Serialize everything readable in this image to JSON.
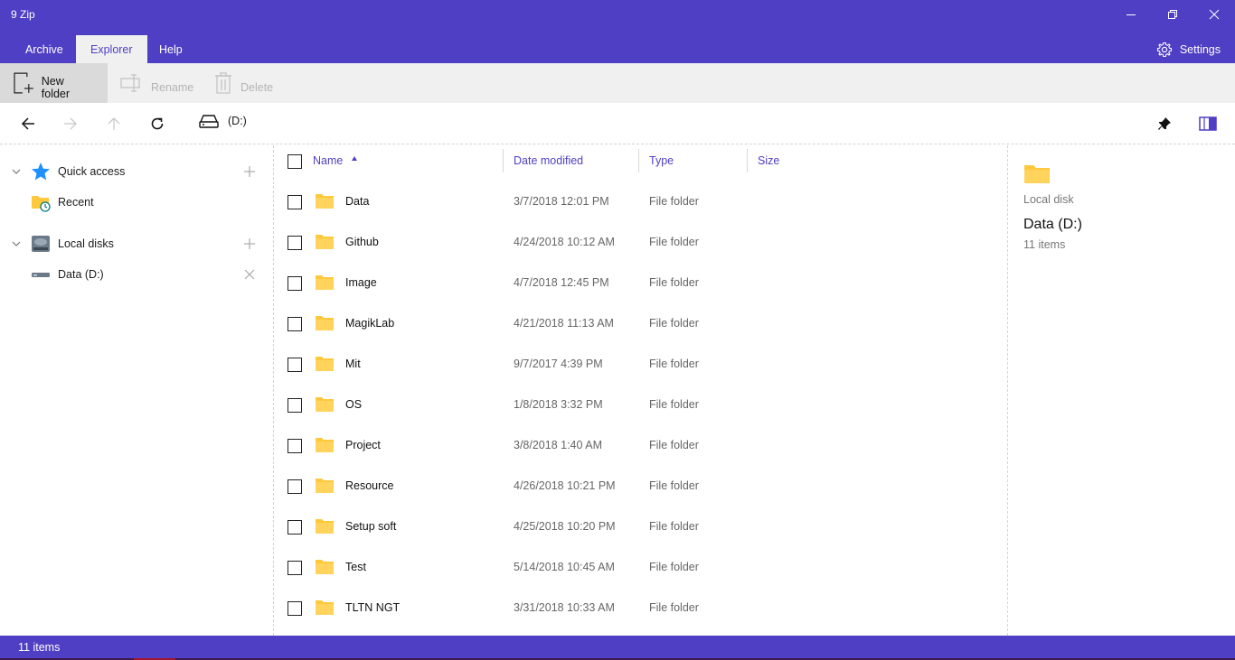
{
  "window": {
    "title": "9 Zip"
  },
  "tabs": [
    {
      "label": "Archive",
      "active": false
    },
    {
      "label": "Explorer",
      "active": true
    },
    {
      "label": "Help",
      "active": false
    }
  ],
  "settings_label": "Settings",
  "ribbon": {
    "new_folder": "New folder",
    "rename": "Rename",
    "delete": "Delete"
  },
  "nav": {
    "path": "(D:)"
  },
  "sidebar": {
    "quick_access": "Quick access",
    "recent": "Recent",
    "local_disks": "Local disks",
    "data_drive": "Data (D:)"
  },
  "columns": {
    "name": "Name",
    "date_modified": "Date modified",
    "type": "Type",
    "size": "Size"
  },
  "files": [
    {
      "name": "Data",
      "date": "3/7/2018 12:01 PM",
      "type": "File folder"
    },
    {
      "name": "Github",
      "date": "4/24/2018 10:12 AM",
      "type": "File folder"
    },
    {
      "name": "Image",
      "date": "4/7/2018 12:45 PM",
      "type": "File folder"
    },
    {
      "name": "MagikLab",
      "date": "4/21/2018 11:13 AM",
      "type": "File folder"
    },
    {
      "name": "Mit",
      "date": "9/7/2017 4:39 PM",
      "type": "File folder"
    },
    {
      "name": "OS",
      "date": "1/8/2018 3:32 PM",
      "type": "File folder"
    },
    {
      "name": "Project",
      "date": "3/8/2018 1:40 AM",
      "type": "File folder"
    },
    {
      "name": "Resource",
      "date": "4/26/2018 10:21 PM",
      "type": "File folder"
    },
    {
      "name": "Setup soft",
      "date": "4/25/2018 10:20 PM",
      "type": "File folder"
    },
    {
      "name": "Test",
      "date": "5/14/2018 10:45 AM",
      "type": "File folder"
    },
    {
      "name": "TLTN NGT",
      "date": "3/31/2018 10:33 AM",
      "type": "File folder"
    }
  ],
  "details": {
    "kind": "Local disk",
    "name": "Data (D:)",
    "count": "11 items"
  },
  "status": {
    "text": "11 items"
  },
  "colors": {
    "accent": "#4f3fc4",
    "folder": "#ffc83d",
    "star": "#1e90ff"
  }
}
